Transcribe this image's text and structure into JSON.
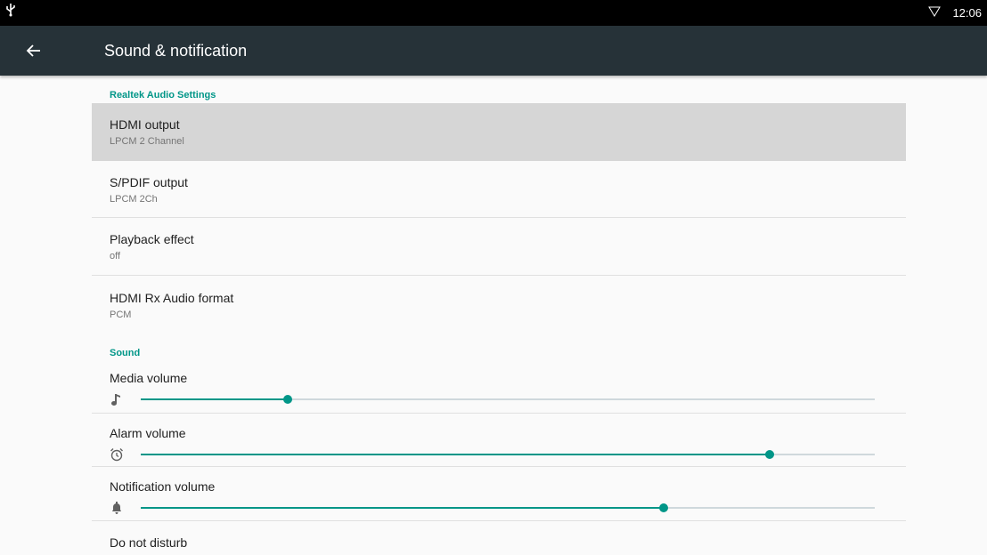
{
  "status_bar": {
    "time": "12:06",
    "icons": [
      "usb-icon",
      "wifi-icon"
    ]
  },
  "toolbar": {
    "title": "Sound & notification",
    "back_icon": "arrow-left-icon"
  },
  "sections": [
    {
      "header": "Realtek Audio Settings",
      "items": [
        {
          "title": "HDMI output",
          "summary": "LPCM 2 Channel",
          "selected": true
        },
        {
          "title": "S/PDIF output",
          "summary": "LPCM 2Ch"
        },
        {
          "title": "Playback effect",
          "summary": "off"
        },
        {
          "title": "HDMI Rx Audio format",
          "summary": "PCM"
        }
      ]
    },
    {
      "header": "Sound",
      "volumes": [
        {
          "title": "Media volume",
          "icon": "music-note-icon",
          "level": 0.2
        },
        {
          "title": "Alarm volume",
          "icon": "alarm-clock-icon",
          "level": 0.857
        },
        {
          "title": "Notification volume",
          "icon": "bell-icon",
          "level": 0.712
        }
      ],
      "items": [
        {
          "title": "Do not disturb"
        }
      ]
    }
  ],
  "colors": {
    "accent": "#009688",
    "toolbar": "#263238",
    "status_bar": "#000000",
    "background": "#fafafa",
    "selected_row": "#d6d6d6"
  }
}
